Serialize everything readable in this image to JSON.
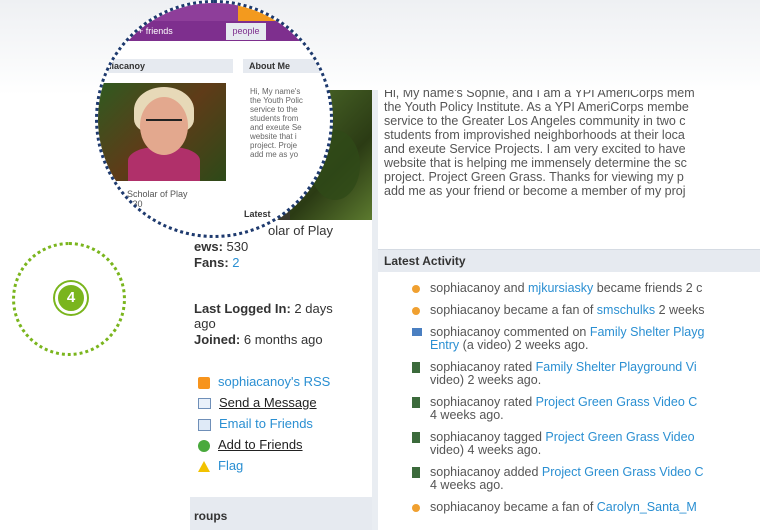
{
  "colors": {
    "link": "#2a8fd2",
    "header_bg": "#e6eaf0",
    "nav_purple": "#7e2f8e",
    "tab_orange": "#f39a1e",
    "step_green": "#7ab51d",
    "zoom_ring": "#1e3a6e"
  },
  "zoom": {
    "tabs": [
      "y profile + friends",
      "people"
    ],
    "name_bar": "hiacanoy",
    "about_bar": "About Me",
    "about_lines": [
      "Hi, My name's",
      "the Youth Polic",
      "service to the",
      "students from",
      "and exeute Se",
      "website that i",
      "project. Proje",
      "add me as yo"
    ],
    "caption_line1": "ic Scholar of Play",
    "caption_line2": "s: 530",
    "latest_bar": "Latest"
  },
  "step": {
    "number": "4"
  },
  "profile": {
    "scholar_text": "olar of Play",
    "views_label": "ews:",
    "views_value": "530",
    "fans_label": "Fans:",
    "fans_value": "2",
    "last_logged_label": "Last Logged In:",
    "last_logged_value": "2 days",
    "last_logged_value2": "ago",
    "joined_label": "Joined:",
    "joined_value": "6 months ago"
  },
  "actions": {
    "rss": "sophiacanoy's RSS",
    "send_message": "Send a Message",
    "email_friends": "Email to Friends",
    "add_friends": "Add to Friends",
    "flag": "Flag"
  },
  "groups_label": "roups",
  "about_text": [
    "Hi, My name's Sophie, and I am a YPI AmeriCorps mem",
    "the Youth Policy Institute. As a YPI AmeriCorps membe",
    "service to the Greater Los Angeles community in two c",
    "students from improvished neighborhoods at their loca",
    "and exeute Service Projects. I am very excited to have",
    "website that is helping me immensely determine the sc",
    "project. Project Green Grass. Thanks for viewing my p",
    "add me as your friend or become a member of my proj"
  ],
  "latest_activity": {
    "heading": "Latest Activity",
    "items": [
      {
        "line1_pre": "sophiacanoy and ",
        "line1_link": "mjkursiasky",
        "line1_post": " became friends 2 c",
        "line2": ""
      },
      {
        "line1_pre": "sophiacanoy became a fan of ",
        "line1_link": "smschulks",
        "line1_post": " 2 weeks",
        "line2": ""
      },
      {
        "line1_pre": "sophiacanoy commented on ",
        "line1_link": "Family Shelter Playg",
        "line1_post": "",
        "line2_link": "Entry",
        "line2": " (a video) 2 weeks ago."
      },
      {
        "line1_pre": "sophiacanoy rated ",
        "line1_link": "Family Shelter Playground Vi",
        "line1_post": "",
        "line2": "video) 2 weeks ago."
      },
      {
        "line1_pre": "sophiacanoy rated ",
        "line1_link": "Project Green Grass Video C",
        "line1_post": "",
        "line2": "4 weeks ago."
      },
      {
        "line1_pre": "sophiacanoy tagged ",
        "line1_link": "Project Green Grass Video",
        "line1_post": "",
        "line2": "video) 4 weeks ago."
      },
      {
        "line1_pre": "sophiacanoy added ",
        "line1_link": "Project Green Grass Video C",
        "line1_post": "",
        "line2": "4 weeks ago."
      },
      {
        "line1_pre": "sophiacanoy became a fan of ",
        "line1_link": "Carolyn_Santa_M",
        "line1_post": "",
        "line2": ""
      }
    ]
  }
}
